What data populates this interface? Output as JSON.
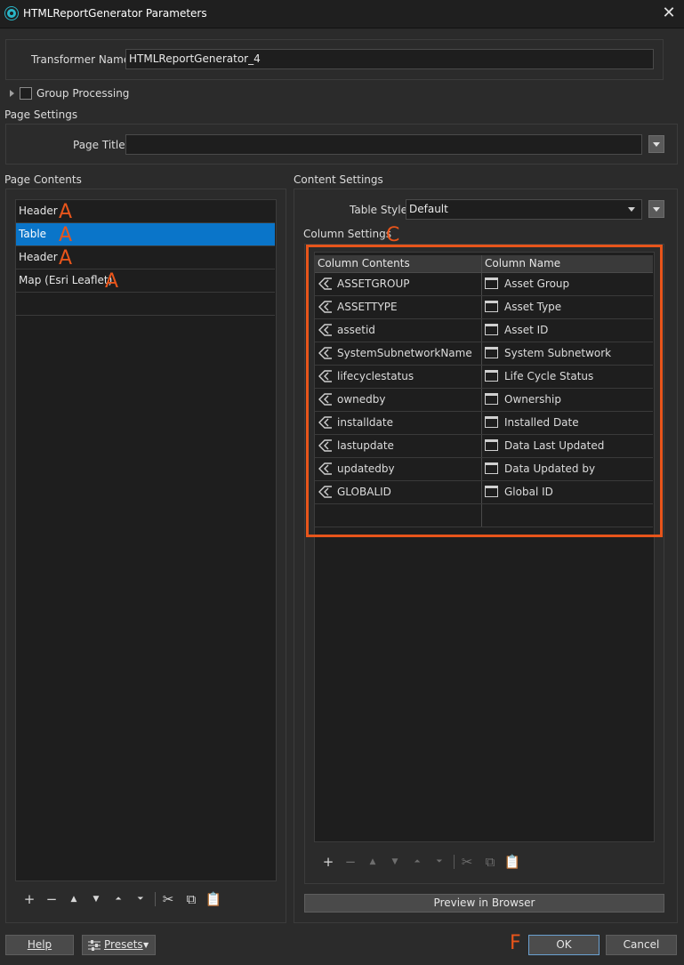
{
  "window": {
    "title": "HTMLReportGenerator Parameters",
    "close_glyph": "✕"
  },
  "transformer": {
    "label": "Transformer Name:",
    "value": "HTMLReportGenerator_4"
  },
  "group_processing": {
    "label": "Group Processing",
    "checked": false
  },
  "page_settings": {
    "header": "Page Settings",
    "page_title_label": "Page Title:",
    "page_title_value": ""
  },
  "page_contents": {
    "header": "Page Contents",
    "items": [
      {
        "label": "Header",
        "selected": false,
        "annotation": "A"
      },
      {
        "label": "Table",
        "selected": true,
        "annotation": "A"
      },
      {
        "label": "Header",
        "selected": false,
        "annotation": "A"
      },
      {
        "label": "Map (Esri Leaflet)",
        "selected": false,
        "annotation": "A"
      }
    ]
  },
  "content_settings": {
    "header": "Content Settings",
    "table_style_label": "Table Style:",
    "table_style_value": "Default",
    "column_settings_label": "Column Settings",
    "column_settings_annotation": "C",
    "columns_header": [
      "Column Contents",
      "Column Name"
    ],
    "rows": [
      {
        "contents": "ASSETGROUP",
        "name": "Asset Group"
      },
      {
        "contents": "ASSETTYPE",
        "name": "Asset Type"
      },
      {
        "contents": "assetid",
        "name": "Asset ID"
      },
      {
        "contents": "SystemSubnetworkName",
        "name": "System Subnetwork"
      },
      {
        "contents": "lifecyclestatus",
        "name": "Life Cycle Status"
      },
      {
        "contents": "ownedby",
        "name": "Ownership"
      },
      {
        "contents": "installdate",
        "name": "Installed Date"
      },
      {
        "contents": "lastupdate",
        "name": "Data Last Updated"
      },
      {
        "contents": "updatedby",
        "name": "Data Updated by"
      },
      {
        "contents": "GLOBALID",
        "name": "Global ID"
      }
    ],
    "preview_button": "Preview in Browser"
  },
  "toolbar_icons": [
    "plus-icon",
    "minus-icon",
    "move-up-icon",
    "move-down-icon",
    "move-top-icon",
    "move-bottom-icon",
    "cut-icon",
    "copy-icon",
    "paste-icon"
  ],
  "footer": {
    "help": "Help",
    "presets": "Presets",
    "ok": "OK",
    "cancel": "Cancel",
    "ok_annotation": "F"
  },
  "colors": {
    "annotation": "#e8551b",
    "selection": "#0a75c9",
    "background": "#2b2b2b"
  }
}
